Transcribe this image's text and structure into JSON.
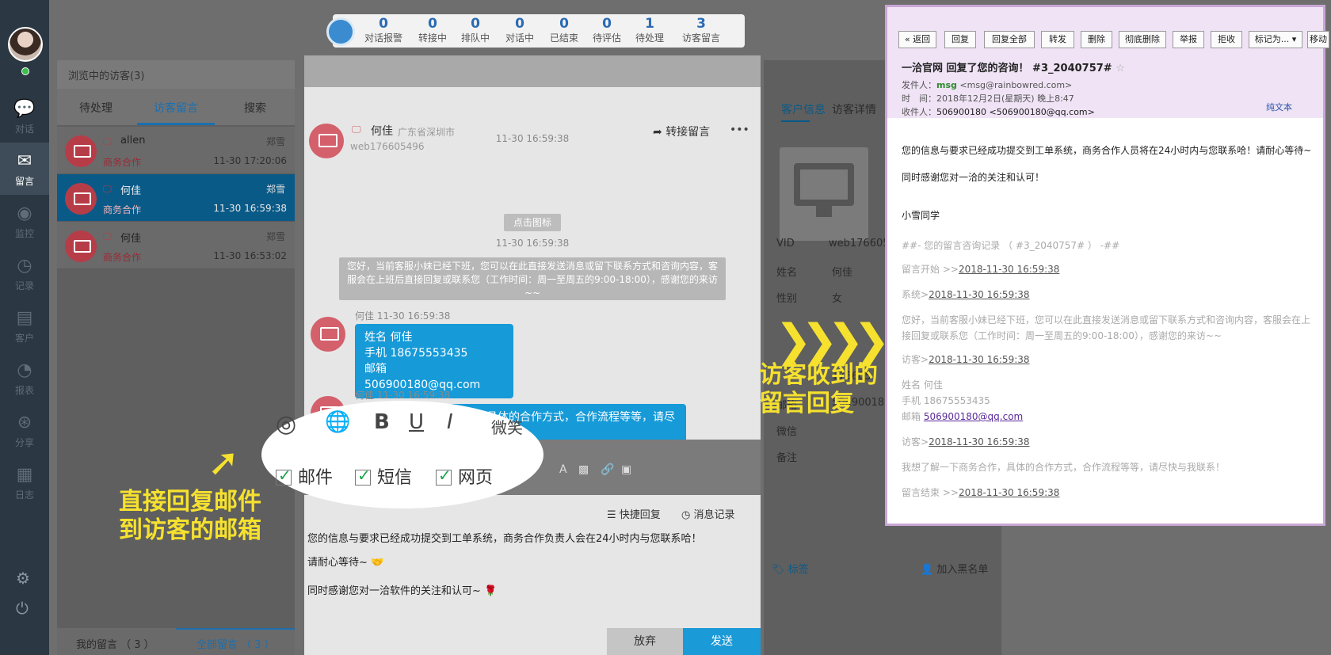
{
  "nav": {
    "items": [
      {
        "icon": "chat-icon",
        "label": "对话"
      },
      {
        "icon": "mail-icon",
        "label": "留言"
      },
      {
        "icon": "eye-icon",
        "label": "监控"
      },
      {
        "icon": "clock-icon",
        "label": "记录"
      },
      {
        "icon": "contact-card-icon",
        "label": "客户"
      },
      {
        "icon": "pie-chart-icon",
        "label": "报表"
      },
      {
        "icon": "share-icon",
        "label": "分享"
      },
      {
        "icon": "clipboard-icon",
        "label": "日志"
      }
    ]
  },
  "stats": [
    {
      "n": "0",
      "label": "对话报警"
    },
    {
      "n": "0",
      "label": "转接中"
    },
    {
      "n": "0",
      "label": "排队中"
    },
    {
      "n": "0",
      "label": "对话中"
    },
    {
      "n": "0",
      "label": "已结束"
    },
    {
      "n": "0",
      "label": "待评估"
    },
    {
      "n": "1",
      "label": "待处理"
    },
    {
      "n": "3",
      "label": "访客留言"
    }
  ],
  "visitors": {
    "header": "浏览中的访客(3)",
    "tabs": [
      "待处理",
      "访客留言",
      "搜索"
    ],
    "rows": [
      {
        "name": "allen",
        "agent": "郑雪",
        "category": "商务合作",
        "time": "11-30 17:20:06"
      },
      {
        "name": "何佳",
        "agent": "郑雪",
        "category": "商务合作",
        "time": "11-30 16:59:38"
      },
      {
        "name": "何佳",
        "agent": "郑雪",
        "category": "商务合作",
        "time": "11-30 16:53:02"
      }
    ],
    "footer": [
      "我的留言 （ 3 ）",
      "全部留言 （ 3 ）"
    ]
  },
  "chat": {
    "visitor_name": "何佳",
    "location": "广东省深圳市",
    "visitor_id": "web176605496",
    "transfer": "转接留言",
    "more": "•••",
    "ts1": "11-30 16:59:38",
    "sys_button": "点击图标",
    "ts2": "11-30 16:59:38",
    "sys_message": "您好，当前客服小妹已经下班，您可以在此直接发送消息或留下联系方式和咨询内容，客服会在上班后直接回复或联系您（工作时间：周一至周五的9:00-18:00），感谢您的来访~~",
    "msg1_meta": "何佳 11-30 16:59:38",
    "msg1_lines": [
      "姓名 何佳",
      "手机 18675553435",
      "邮箱 506900180@qq.com"
    ],
    "msg2_meta": "何佳 11-30 16:59:38",
    "msg2": "我想了解一下商务合作，具体的合作方式，合作流程等等，请尽快与我联系！",
    "quick_reply": "快捷回复",
    "msg_record": "消息记录",
    "compose_line1": "您的信息与要求已经成功提交到工单系统，商务合作负责人会在24小时内与您联系哈！",
    "compose_line2": "请耐心等待~",
    "compose_line3": "同时感谢您对一洽软件的关注和认可~",
    "give_up": "放弃",
    "send": "发送"
  },
  "zoom": {
    "options": [
      "邮件",
      "短信",
      "网页"
    ],
    "partial_text": "微笑"
  },
  "info": {
    "tabs": [
      "客户信息",
      "访客详情"
    ],
    "fields": [
      {
        "label": "VID",
        "value": "web176605"
      },
      {
        "label": "姓名",
        "value": "何佳"
      },
      {
        "label": "性别",
        "value": "女"
      },
      {
        "label": "邮箱",
        "value": "50690018"
      },
      {
        "label": "微信",
        "value": ""
      },
      {
        "label": "备注",
        "value": ""
      }
    ],
    "partial_value": "176605",
    "tag": "标签",
    "blacklist": "加入黑名单"
  },
  "annotations": {
    "left": [
      "直接回复邮件",
      "到访客的邮箱"
    ],
    "right": [
      "访客收到的",
      "留言回复"
    ]
  },
  "mail": {
    "buttons": [
      "« 返回",
      "回复",
      "回复全部",
      "转发",
      "删除",
      "彻底删除",
      "举报",
      "拒收",
      "标记为... ▾",
      "移动"
    ],
    "subject": "一洽官网 回复了您的咨询！ #3_2040757#",
    "from_label": "发件人：",
    "from_name": "msg",
    "from_addr": "<msg@rainbowred.com>",
    "time_label": "时　间：",
    "time": "2018年12月2日(星期天) 晚上8:47",
    "to_label": "收件人：",
    "to": "506900180 <506900180@qq.com>",
    "plain_text": "纯文本",
    "body1": "您的信息与要求已经成功提交到工单系统，商务合作人员将在24小时内与您联系哈！请耐心等待~",
    "body2": "同时感谢您对一洽的关注和认可！",
    "signature": "小雪同学",
    "rec_title": "##- 您的留言咨询记录 （ #3_2040757# ） -##",
    "rec_start_label": "留言开始 >>",
    "rec_start": "2018-11-30 16:59:38",
    "rec_sys_label": "系统>",
    "rec_sys": "2018-11-30 16:59:38",
    "rec_sys_msg1": "您好，当前客服小妹已经下班，您可以在此直接发送消息或留下联系方式和咨询内容，客服会在上",
    "rec_sys_msg2": "接回复或联系您（工作时间：周一至周五的9:00-18:00），感谢您的来访~~",
    "rec_v1_label": "访客>",
    "rec_v1": "2018-11-30 16:59:38",
    "rec_name": "姓名 何佳",
    "rec_phone": "手机 18675553435",
    "rec_email_label": "邮箱 ",
    "rec_email": "506900180@qq.com",
    "rec_v2_label": "访客>",
    "rec_v2": "2018-11-30 16:59:38",
    "rec_v2_msg": "我想了解一下商务合作，具体的合作方式，合作流程等等，请尽快与我联系！",
    "rec_end_label": "留言结束 >>",
    "rec_end": "2018-11-30 16:59:38"
  }
}
